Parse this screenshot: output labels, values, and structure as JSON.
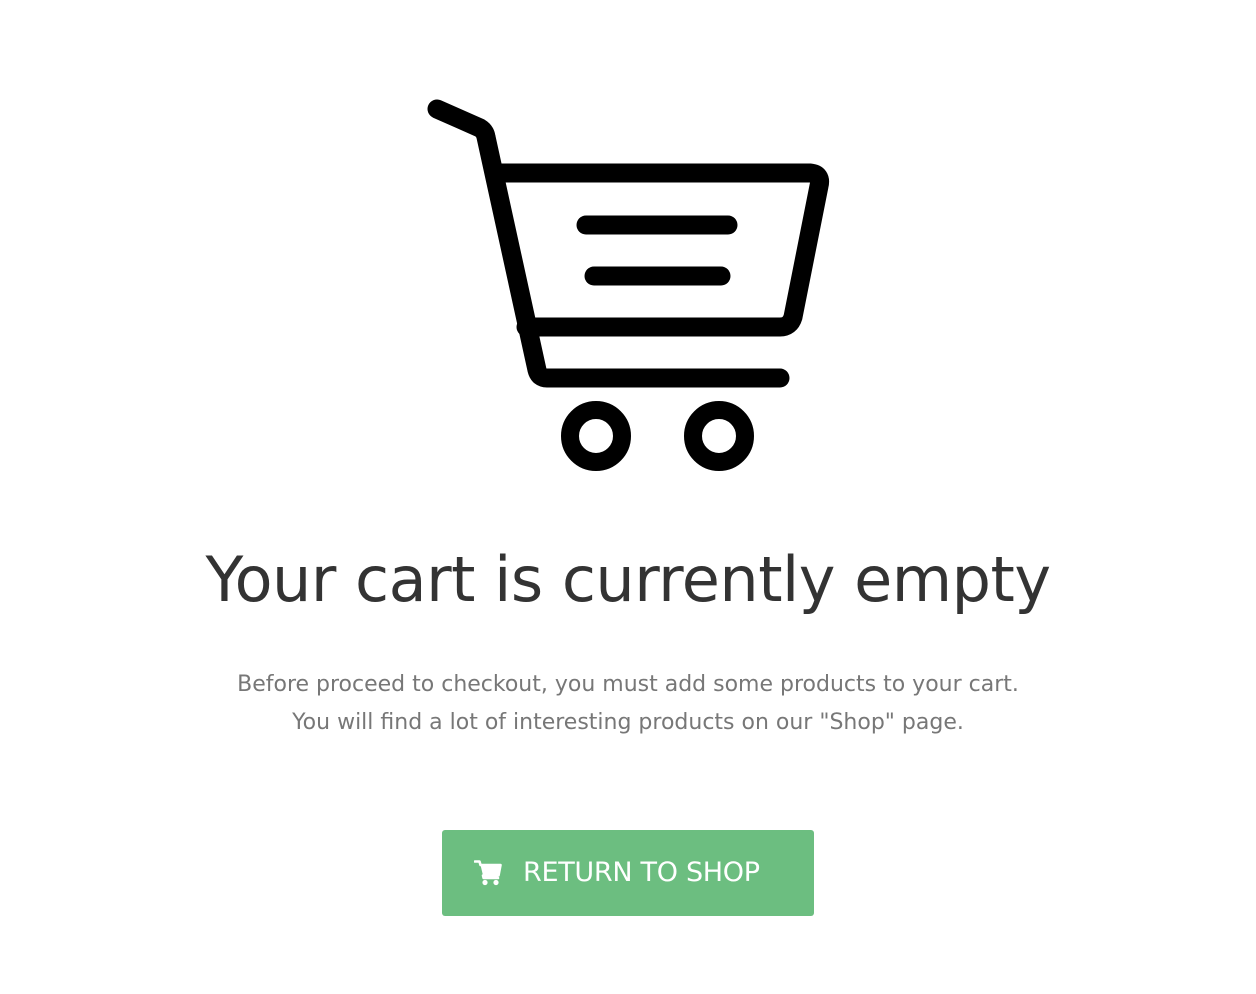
{
  "empty_cart": {
    "illustration_icon": "shopping-cart-icon",
    "title": "Your cart is currently empty",
    "message_lines": [
      "Before proceed to checkout, you must add some products to your cart.",
      "You will find a lot of interesting products on our \"Shop\" page."
    ],
    "button": {
      "label": "RETURN TO SHOP",
      "icon": "shopping-cart-icon"
    }
  },
  "colors": {
    "button_background": "#6cbe80",
    "button_text": "#ffffff",
    "title_text": "#333333",
    "message_text": "#777777",
    "icon_stroke": "#000000"
  }
}
